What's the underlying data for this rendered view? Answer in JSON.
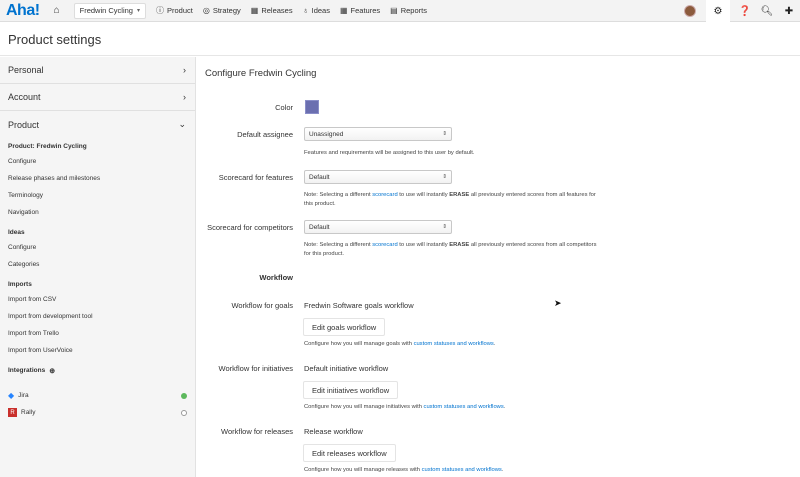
{
  "nav": {
    "logo": "Aha!",
    "home_icon": "home-icon",
    "product_selector": "Fredwin Cycling",
    "items": [
      {
        "icon": "info-icon",
        "glyph": "ⓘ",
        "label": "Product"
      },
      {
        "icon": "target-icon",
        "glyph": "◎",
        "label": "Strategy"
      },
      {
        "icon": "calendar-icon",
        "glyph": "▦",
        "label": "Releases"
      },
      {
        "icon": "lightbulb-icon",
        "glyph": "♁",
        "label": "Ideas"
      },
      {
        "icon": "grid-icon",
        "glyph": "▦",
        "label": "Features"
      },
      {
        "icon": "reports-icon",
        "glyph": "▤",
        "label": "Reports"
      }
    ]
  },
  "page": {
    "title": "Product settings"
  },
  "sidebar": {
    "personal": "Personal",
    "account": "Account",
    "product": "Product",
    "product_section": "Product: Fredwin Cycling",
    "product_items": [
      "Configure",
      "Release phases and milestones",
      "Terminology",
      "Navigation"
    ],
    "ideas_section": "Ideas",
    "ideas_items": [
      "Configure",
      "Categories"
    ],
    "imports_section": "Imports",
    "imports_items": [
      "Import from CSV",
      "Import from development tool",
      "Import from Trello",
      "Import from UserVoice"
    ],
    "integrations_section": "Integrations",
    "integrations": [
      {
        "label": "Jira",
        "status_color": "#5cb85c"
      },
      {
        "label": "Rally",
        "status_color": "#ffffff"
      }
    ]
  },
  "main": {
    "title": "Configure Fredwin Cycling",
    "color_label": "Color",
    "color_value": "#6b6fb0",
    "assignee_label": "Default assignee",
    "assignee_value": "Unassigned",
    "assignee_note": "Features and requirements will be assigned to this user by default.",
    "scorecard_features_label": "Scorecard for features",
    "scorecard_features_value": "Default",
    "scorecard_features_note_pre": "Note: Selecting a different ",
    "scorecard_link": "scorecard",
    "scorecard_features_note_mid": " to use will instantly ",
    "erase": "ERASE",
    "scorecard_features_note_post": " all previously entered scores from all features for this product.",
    "scorecard_competitors_label": "Scorecard for competitors",
    "scorecard_competitors_value": "Default",
    "scorecard_competitors_note_post": " all previously entered scores from all competitors for this product.",
    "workflow_heading": "Workflow",
    "goals_label": "Workflow for goals",
    "goals_value": "Fredwin Software goals workflow",
    "goals_button": "Edit goals workflow",
    "goals_note_pre": "Configure how you will manage goals with ",
    "initiatives_label": "Workflow for initiatives",
    "initiatives_value": "Default initiative workflow",
    "initiatives_button": "Edit initiatives workflow",
    "initiatives_note_pre": "Configure how you will manage initiatives with ",
    "releases_label": "Workflow for releases",
    "releases_value": "Release workflow",
    "releases_button": "Edit releases workflow",
    "releases_note_pre": "Configure how you will manage releases with ",
    "custom_link": "custom statuses and workflows",
    "period": "."
  }
}
